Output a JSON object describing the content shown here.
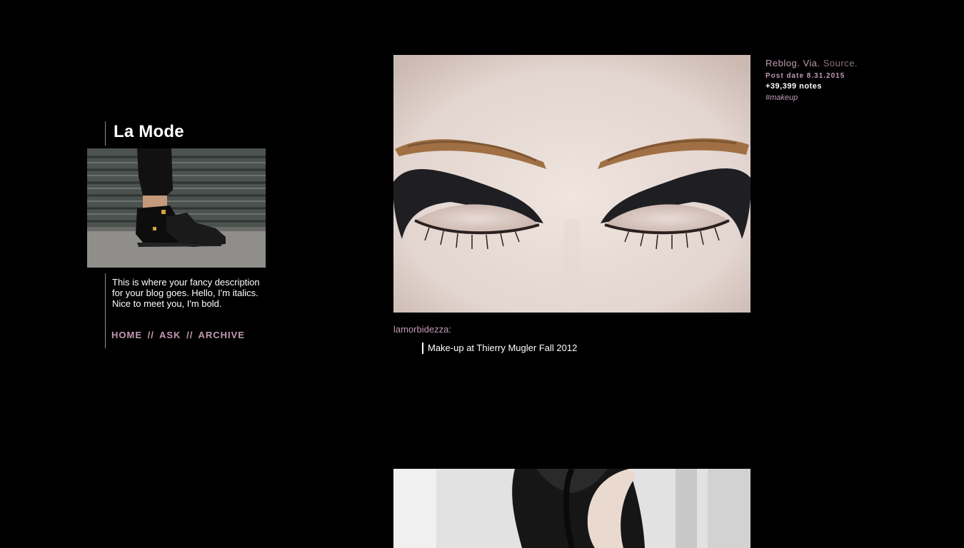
{
  "blog": {
    "title": "La Mode",
    "description": "This is where your fancy description for your blog goes. Hello, I'm italics. Nice to meet you, I'm bold.",
    "nav": {
      "home": "HOME",
      "separator": "//",
      "ask": "ASK",
      "archive": "ARCHIVE"
    }
  },
  "post": {
    "author": "lamorbidezza",
    "author_suffix": ":",
    "quote": "Make-up at Thierry Mugler Fall 2012",
    "meta": {
      "reblog": "Reblog.",
      "via": "Via.",
      "source": "Source.",
      "post_date": "Post date 8.31.2015",
      "notes": "+39,399 notes",
      "tag": "#makeup"
    }
  },
  "colors": {
    "background": "#000000",
    "accent": "#c29ab3",
    "text": "#ffffff"
  }
}
